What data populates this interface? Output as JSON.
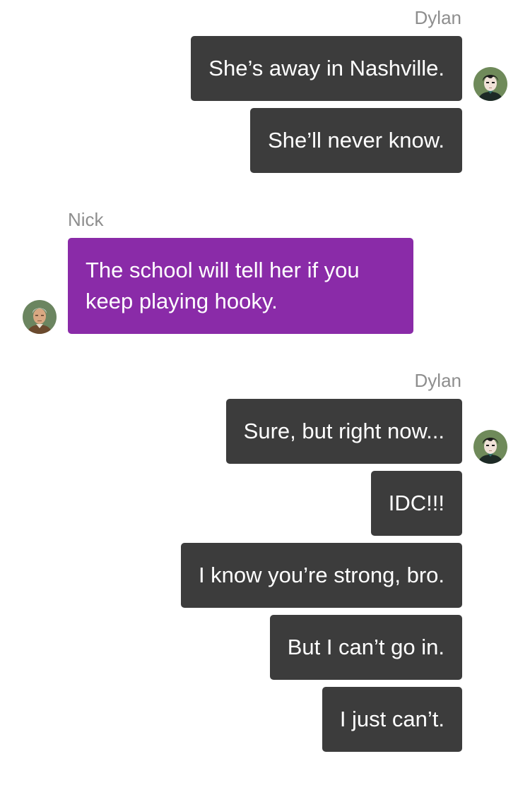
{
  "conversation": {
    "group_1": {
      "sender": "Dylan",
      "messages": [
        "She’s away in Nashville.",
        "She’ll never know."
      ]
    },
    "group_2": {
      "sender": "Nick",
      "messages": [
        "The school will tell her if you keep playing hooky."
      ]
    },
    "group_3": {
      "sender": "Dylan",
      "messages": [
        "Sure, but right now...",
        "IDC!!!",
        "I know you’re strong, bro.",
        "But I can’t go in.",
        "I just can’t."
      ]
    }
  },
  "avatars": {
    "dylan": {
      "name": "dylan-avatar",
      "bg": "#6f8a5a",
      "hair": "#1a1a1a",
      "skin": "#f0e2d8"
    },
    "nick": {
      "name": "nick-avatar",
      "bg": "#6b8560",
      "hair": "#e8e8e8",
      "skin": "#d9a882"
    }
  },
  "colors": {
    "outgoing_bubble": "#3c3c3c",
    "incoming_bubble": "#8a2ba8",
    "sender_label": "#8e8e8e"
  }
}
